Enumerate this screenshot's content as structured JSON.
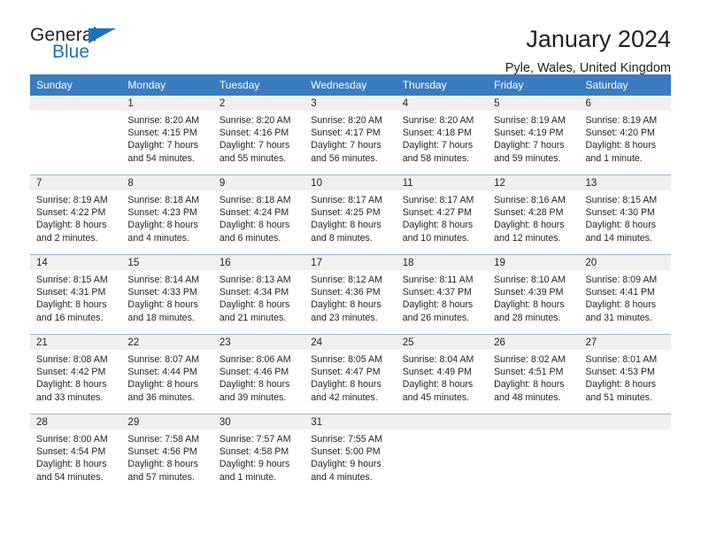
{
  "brand": {
    "name_part1": "General",
    "name_part2": "Blue"
  },
  "header": {
    "title": "January 2024",
    "location": "Pyle, Wales, United Kingdom"
  },
  "weekday_headers": [
    "Sunday",
    "Monday",
    "Tuesday",
    "Wednesday",
    "Thursday",
    "Friday",
    "Saturday"
  ],
  "colors": {
    "header_bar": "#3a7cbe",
    "daynum_band": "#f0f0f0",
    "row_divider": "#9ab4d0",
    "brand_blue": "#1b74bb",
    "text": "#231f20"
  },
  "weeks": [
    [
      {
        "day": "",
        "empty": true
      },
      {
        "day": "1",
        "sunrise": "Sunrise: 8:20 AM",
        "sunset": "Sunset: 4:15 PM",
        "daylight1": "Daylight: 7 hours",
        "daylight2": "and 54 minutes."
      },
      {
        "day": "2",
        "sunrise": "Sunrise: 8:20 AM",
        "sunset": "Sunset: 4:16 PM",
        "daylight1": "Daylight: 7 hours",
        "daylight2": "and 55 minutes."
      },
      {
        "day": "3",
        "sunrise": "Sunrise: 8:20 AM",
        "sunset": "Sunset: 4:17 PM",
        "daylight1": "Daylight: 7 hours",
        "daylight2": "and 56 minutes."
      },
      {
        "day": "4",
        "sunrise": "Sunrise: 8:20 AM",
        "sunset": "Sunset: 4:18 PM",
        "daylight1": "Daylight: 7 hours",
        "daylight2": "and 58 minutes."
      },
      {
        "day": "5",
        "sunrise": "Sunrise: 8:19 AM",
        "sunset": "Sunset: 4:19 PM",
        "daylight1": "Daylight: 7 hours",
        "daylight2": "and 59 minutes."
      },
      {
        "day": "6",
        "sunrise": "Sunrise: 8:19 AM",
        "sunset": "Sunset: 4:20 PM",
        "daylight1": "Daylight: 8 hours",
        "daylight2": "and 1 minute."
      }
    ],
    [
      {
        "day": "7",
        "sunrise": "Sunrise: 8:19 AM",
        "sunset": "Sunset: 4:22 PM",
        "daylight1": "Daylight: 8 hours",
        "daylight2": "and 2 minutes."
      },
      {
        "day": "8",
        "sunrise": "Sunrise: 8:18 AM",
        "sunset": "Sunset: 4:23 PM",
        "daylight1": "Daylight: 8 hours",
        "daylight2": "and 4 minutes."
      },
      {
        "day": "9",
        "sunrise": "Sunrise: 8:18 AM",
        "sunset": "Sunset: 4:24 PM",
        "daylight1": "Daylight: 8 hours",
        "daylight2": "and 6 minutes."
      },
      {
        "day": "10",
        "sunrise": "Sunrise: 8:17 AM",
        "sunset": "Sunset: 4:25 PM",
        "daylight1": "Daylight: 8 hours",
        "daylight2": "and 8 minutes."
      },
      {
        "day": "11",
        "sunrise": "Sunrise: 8:17 AM",
        "sunset": "Sunset: 4:27 PM",
        "daylight1": "Daylight: 8 hours",
        "daylight2": "and 10 minutes."
      },
      {
        "day": "12",
        "sunrise": "Sunrise: 8:16 AM",
        "sunset": "Sunset: 4:28 PM",
        "daylight1": "Daylight: 8 hours",
        "daylight2": "and 12 minutes."
      },
      {
        "day": "13",
        "sunrise": "Sunrise: 8:15 AM",
        "sunset": "Sunset: 4:30 PM",
        "daylight1": "Daylight: 8 hours",
        "daylight2": "and 14 minutes."
      }
    ],
    [
      {
        "day": "14",
        "sunrise": "Sunrise: 8:15 AM",
        "sunset": "Sunset: 4:31 PM",
        "daylight1": "Daylight: 8 hours",
        "daylight2": "and 16 minutes."
      },
      {
        "day": "15",
        "sunrise": "Sunrise: 8:14 AM",
        "sunset": "Sunset: 4:33 PM",
        "daylight1": "Daylight: 8 hours",
        "daylight2": "and 18 minutes."
      },
      {
        "day": "16",
        "sunrise": "Sunrise: 8:13 AM",
        "sunset": "Sunset: 4:34 PM",
        "daylight1": "Daylight: 8 hours",
        "daylight2": "and 21 minutes."
      },
      {
        "day": "17",
        "sunrise": "Sunrise: 8:12 AM",
        "sunset": "Sunset: 4:36 PM",
        "daylight1": "Daylight: 8 hours",
        "daylight2": "and 23 minutes."
      },
      {
        "day": "18",
        "sunrise": "Sunrise: 8:11 AM",
        "sunset": "Sunset: 4:37 PM",
        "daylight1": "Daylight: 8 hours",
        "daylight2": "and 26 minutes."
      },
      {
        "day": "19",
        "sunrise": "Sunrise: 8:10 AM",
        "sunset": "Sunset: 4:39 PM",
        "daylight1": "Daylight: 8 hours",
        "daylight2": "and 28 minutes."
      },
      {
        "day": "20",
        "sunrise": "Sunrise: 8:09 AM",
        "sunset": "Sunset: 4:41 PM",
        "daylight1": "Daylight: 8 hours",
        "daylight2": "and 31 minutes."
      }
    ],
    [
      {
        "day": "21",
        "sunrise": "Sunrise: 8:08 AM",
        "sunset": "Sunset: 4:42 PM",
        "daylight1": "Daylight: 8 hours",
        "daylight2": "and 33 minutes."
      },
      {
        "day": "22",
        "sunrise": "Sunrise: 8:07 AM",
        "sunset": "Sunset: 4:44 PM",
        "daylight1": "Daylight: 8 hours",
        "daylight2": "and 36 minutes."
      },
      {
        "day": "23",
        "sunrise": "Sunrise: 8:06 AM",
        "sunset": "Sunset: 4:46 PM",
        "daylight1": "Daylight: 8 hours",
        "daylight2": "and 39 minutes."
      },
      {
        "day": "24",
        "sunrise": "Sunrise: 8:05 AM",
        "sunset": "Sunset: 4:47 PM",
        "daylight1": "Daylight: 8 hours",
        "daylight2": "and 42 minutes."
      },
      {
        "day": "25",
        "sunrise": "Sunrise: 8:04 AM",
        "sunset": "Sunset: 4:49 PM",
        "daylight1": "Daylight: 8 hours",
        "daylight2": "and 45 minutes."
      },
      {
        "day": "26",
        "sunrise": "Sunrise: 8:02 AM",
        "sunset": "Sunset: 4:51 PM",
        "daylight1": "Daylight: 8 hours",
        "daylight2": "and 48 minutes."
      },
      {
        "day": "27",
        "sunrise": "Sunrise: 8:01 AM",
        "sunset": "Sunset: 4:53 PM",
        "daylight1": "Daylight: 8 hours",
        "daylight2": "and 51 minutes."
      }
    ],
    [
      {
        "day": "28",
        "sunrise": "Sunrise: 8:00 AM",
        "sunset": "Sunset: 4:54 PM",
        "daylight1": "Daylight: 8 hours",
        "daylight2": "and 54 minutes."
      },
      {
        "day": "29",
        "sunrise": "Sunrise: 7:58 AM",
        "sunset": "Sunset: 4:56 PM",
        "daylight1": "Daylight: 8 hours",
        "daylight2": "and 57 minutes."
      },
      {
        "day": "30",
        "sunrise": "Sunrise: 7:57 AM",
        "sunset": "Sunset: 4:58 PM",
        "daylight1": "Daylight: 9 hours",
        "daylight2": "and 1 minute."
      },
      {
        "day": "31",
        "sunrise": "Sunrise: 7:55 AM",
        "sunset": "Sunset: 5:00 PM",
        "daylight1": "Daylight: 9 hours",
        "daylight2": "and 4 minutes."
      },
      {
        "day": "",
        "empty": true
      },
      {
        "day": "",
        "empty": true
      },
      {
        "day": "",
        "empty": true
      }
    ]
  ]
}
